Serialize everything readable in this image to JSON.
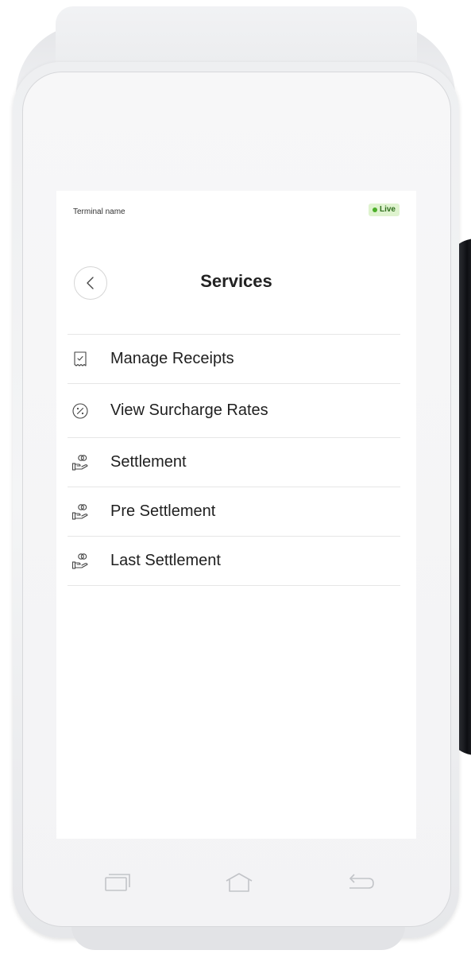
{
  "status_bar": {
    "terminal_name": "Terminal name",
    "badge_label": "Live",
    "badge_color": "#4caf2a"
  },
  "header": {
    "title": "Services",
    "back_icon": "chevron-left-icon"
  },
  "menu": {
    "items": [
      {
        "label": "Manage Receipts",
        "icon": "receipt-icon"
      },
      {
        "label": "View Surcharge Rates",
        "icon": "percent-circle-icon"
      },
      {
        "label": "Settlement",
        "icon": "hand-coins-icon"
      },
      {
        "label": "Pre Settlement",
        "icon": "hand-coins-icon"
      },
      {
        "label": "Last Settlement",
        "icon": "hand-coins-icon"
      }
    ]
  },
  "nav_bar": {
    "recent_icon": "recent-apps-icon",
    "home_icon": "home-icon",
    "back_icon": "back-arrow-icon"
  }
}
